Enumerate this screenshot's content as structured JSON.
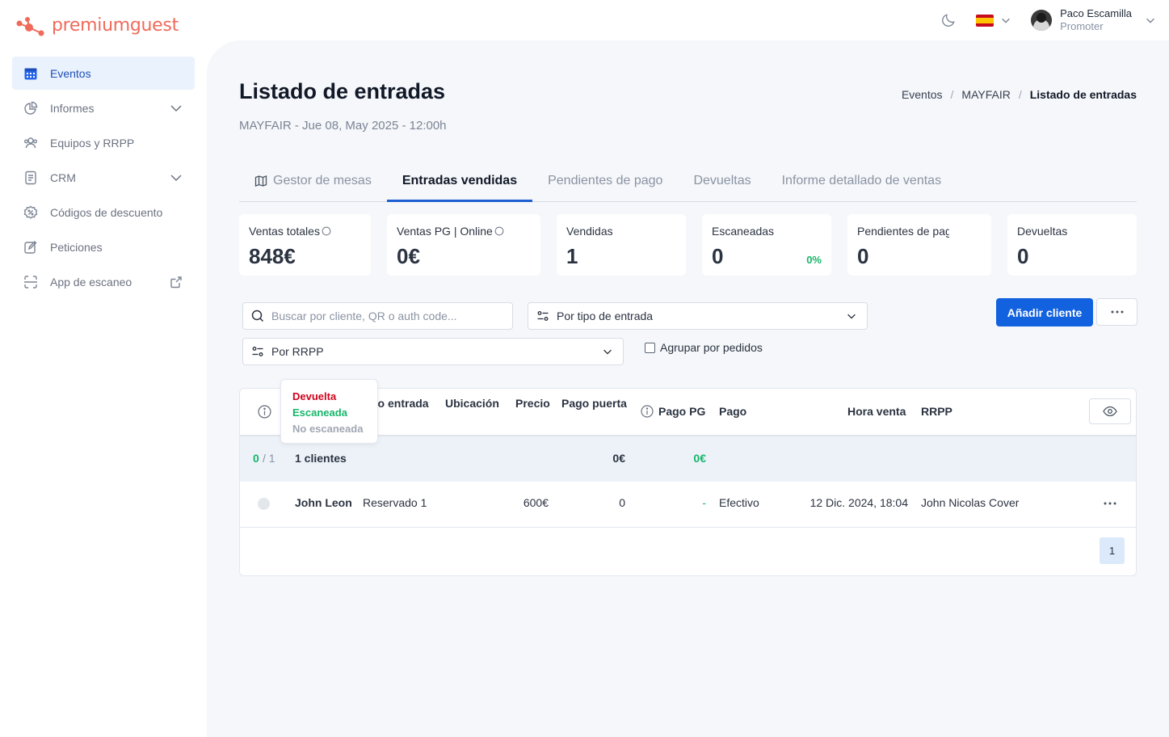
{
  "brand": {
    "name": "premiumguest"
  },
  "user": {
    "name": "Paco Escamilla",
    "role": "Promoter"
  },
  "colors": {
    "accent": "#1262e0",
    "brand": "#f06a5a",
    "green": "#16b66a",
    "red": "#d0021b"
  },
  "sidebar": {
    "items": [
      {
        "label": "Eventos",
        "icon": "calendar-icon"
      },
      {
        "label": "Informes",
        "icon": "pie-chart-icon"
      },
      {
        "label": "Equipos y RRPP",
        "icon": "users-icon"
      },
      {
        "label": "CRM",
        "icon": "document-icon"
      },
      {
        "label": "Códigos de descuento",
        "icon": "discount-icon"
      },
      {
        "label": "Peticiones",
        "icon": "edit-icon"
      },
      {
        "label": "App de escaneo",
        "icon": "scan-icon"
      }
    ]
  },
  "page": {
    "title": "Listado de entradas",
    "subtitle": "MAYFAIR - Jue 08, May 2025 - 12:00h",
    "breadcrumb": [
      "Eventos",
      "MAYFAIR",
      "Listado de entradas"
    ]
  },
  "tabs": [
    "Gestor de mesas",
    "Entradas vendidas",
    "Pendientes de pago",
    "Devueltas",
    "Informe detallado de ventas"
  ],
  "stats": [
    {
      "label": "Ventas totales",
      "value": "848€"
    },
    {
      "label": "Ventas PG | Online",
      "value": "0€"
    },
    {
      "label": "Vendidas",
      "value": "1"
    },
    {
      "label": "Escaneadas",
      "value": "0",
      "pct": "0%"
    },
    {
      "label": "Pendientes de pago",
      "value": "0"
    },
    {
      "label": "Devueltas",
      "value": "0"
    }
  ],
  "filters": {
    "search_placeholder": "Buscar por cliente, QR o auth code...",
    "ticket_type": "Por tipo de entrada",
    "rrpp": "Por RRPP",
    "group_label": "Agrupar por pedidos",
    "add_client": "Añadir cliente"
  },
  "table": {
    "headers": {
      "ticket_type": "po entrada",
      "location": "Ubicación",
      "price": "Precio",
      "door_payment": "Pago puerta",
      "pg_payment": "Pago PG",
      "payment": "Pago",
      "sale_time": "Hora venta",
      "rrpp": "RRPP"
    },
    "summary": {
      "scanned": "0",
      "total": "/ 1",
      "clients": "1 clientes",
      "door_total": "0€",
      "pg_total": "0€"
    },
    "rows": [
      {
        "name": "John Leon",
        "ticket_type": "Reservado 1",
        "price": "600€",
        "door_payment": "0",
        "pg_payment": "-",
        "payment": "Efectivo",
        "sale_time": "12 Dic. 2024, 18:04",
        "rrpp": "John Nicolas Cover"
      }
    ],
    "page": "1"
  },
  "status_legend": [
    "Devuelta",
    "Escaneada",
    "No escaneada"
  ]
}
